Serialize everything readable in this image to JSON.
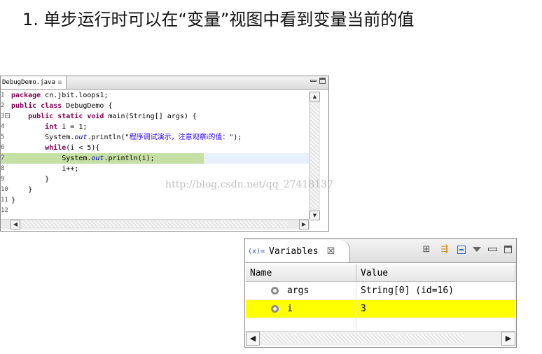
{
  "slide": {
    "title": "1. 单步运行时可以在“变量”视图中看到变量当前的值"
  },
  "editor": {
    "tab_label": "DebugDemo.java",
    "tab_close": "☒",
    "lines": [
      {
        "num": "1",
        "parts": [
          {
            "t": "package",
            "c": "kw"
          },
          {
            "t": " cn.jbit.loops1;",
            "c": ""
          }
        ]
      },
      {
        "num": "2",
        "parts": [
          {
            "t": "public class",
            "c": "kw"
          },
          {
            "t": " DebugDemo {",
            "c": ""
          }
        ]
      },
      {
        "num": "3",
        "fold": "−",
        "parts": [
          {
            "t": "    public static void",
            "c": "kw"
          },
          {
            "t": " main(String[] args) {",
            "c": ""
          }
        ]
      },
      {
        "num": "4",
        "parts": [
          {
            "t": "        ",
            "c": ""
          },
          {
            "t": "int",
            "c": "kw"
          },
          {
            "t": " i = 1;",
            "c": ""
          }
        ]
      },
      {
        "num": "5",
        "parts": [
          {
            "t": "        System.",
            "c": ""
          },
          {
            "t": "out",
            "c": "it"
          },
          {
            "t": ".println(\"",
            "c": ""
          },
          {
            "t": "程序调试演示，注意观察i的值：",
            "c": "str"
          },
          {
            "t": "\");",
            "c": ""
          }
        ]
      },
      {
        "num": "6",
        "parts": [
          {
            "t": "        ",
            "c": ""
          },
          {
            "t": "while",
            "c": "kw"
          },
          {
            "t": "(i < 5){",
            "c": ""
          }
        ]
      },
      {
        "num": "7",
        "current": true,
        "parts": [
          {
            "t": "            System.",
            "c": ""
          },
          {
            "t": "out",
            "c": "it"
          },
          {
            "t": ".println(i);",
            "c": ""
          }
        ]
      },
      {
        "num": "8",
        "parts": [
          {
            "t": "            i++;",
            "c": ""
          }
        ]
      },
      {
        "num": "9",
        "parts": [
          {
            "t": "        }",
            "c": ""
          }
        ]
      },
      {
        "num": "10",
        "parts": [
          {
            "t": "    }",
            "c": ""
          }
        ]
      },
      {
        "num": "11",
        "parts": [
          {
            "t": "}",
            "c": ""
          }
        ]
      },
      {
        "num": "12",
        "parts": [
          {
            "t": "",
            "c": ""
          }
        ]
      }
    ],
    "watermark": "http://blog.csdn.net/qq_27418137"
  },
  "variables_view": {
    "title": "Variables",
    "tab_icon": "(x)=",
    "close_glyph": "☒",
    "columns": [
      "Name",
      "Value"
    ],
    "rows": [
      {
        "name": "args",
        "value": "String[0]  (id=16)",
        "selected": false
      },
      {
        "name": "i",
        "value": "3",
        "selected": true
      }
    ],
    "toolbar_icons": [
      "show-type-names-icon",
      "show-logical-structure-icon",
      "collapse-all-icon",
      "view-menu-icon",
      "minimize-icon",
      "maximize-icon"
    ]
  }
}
